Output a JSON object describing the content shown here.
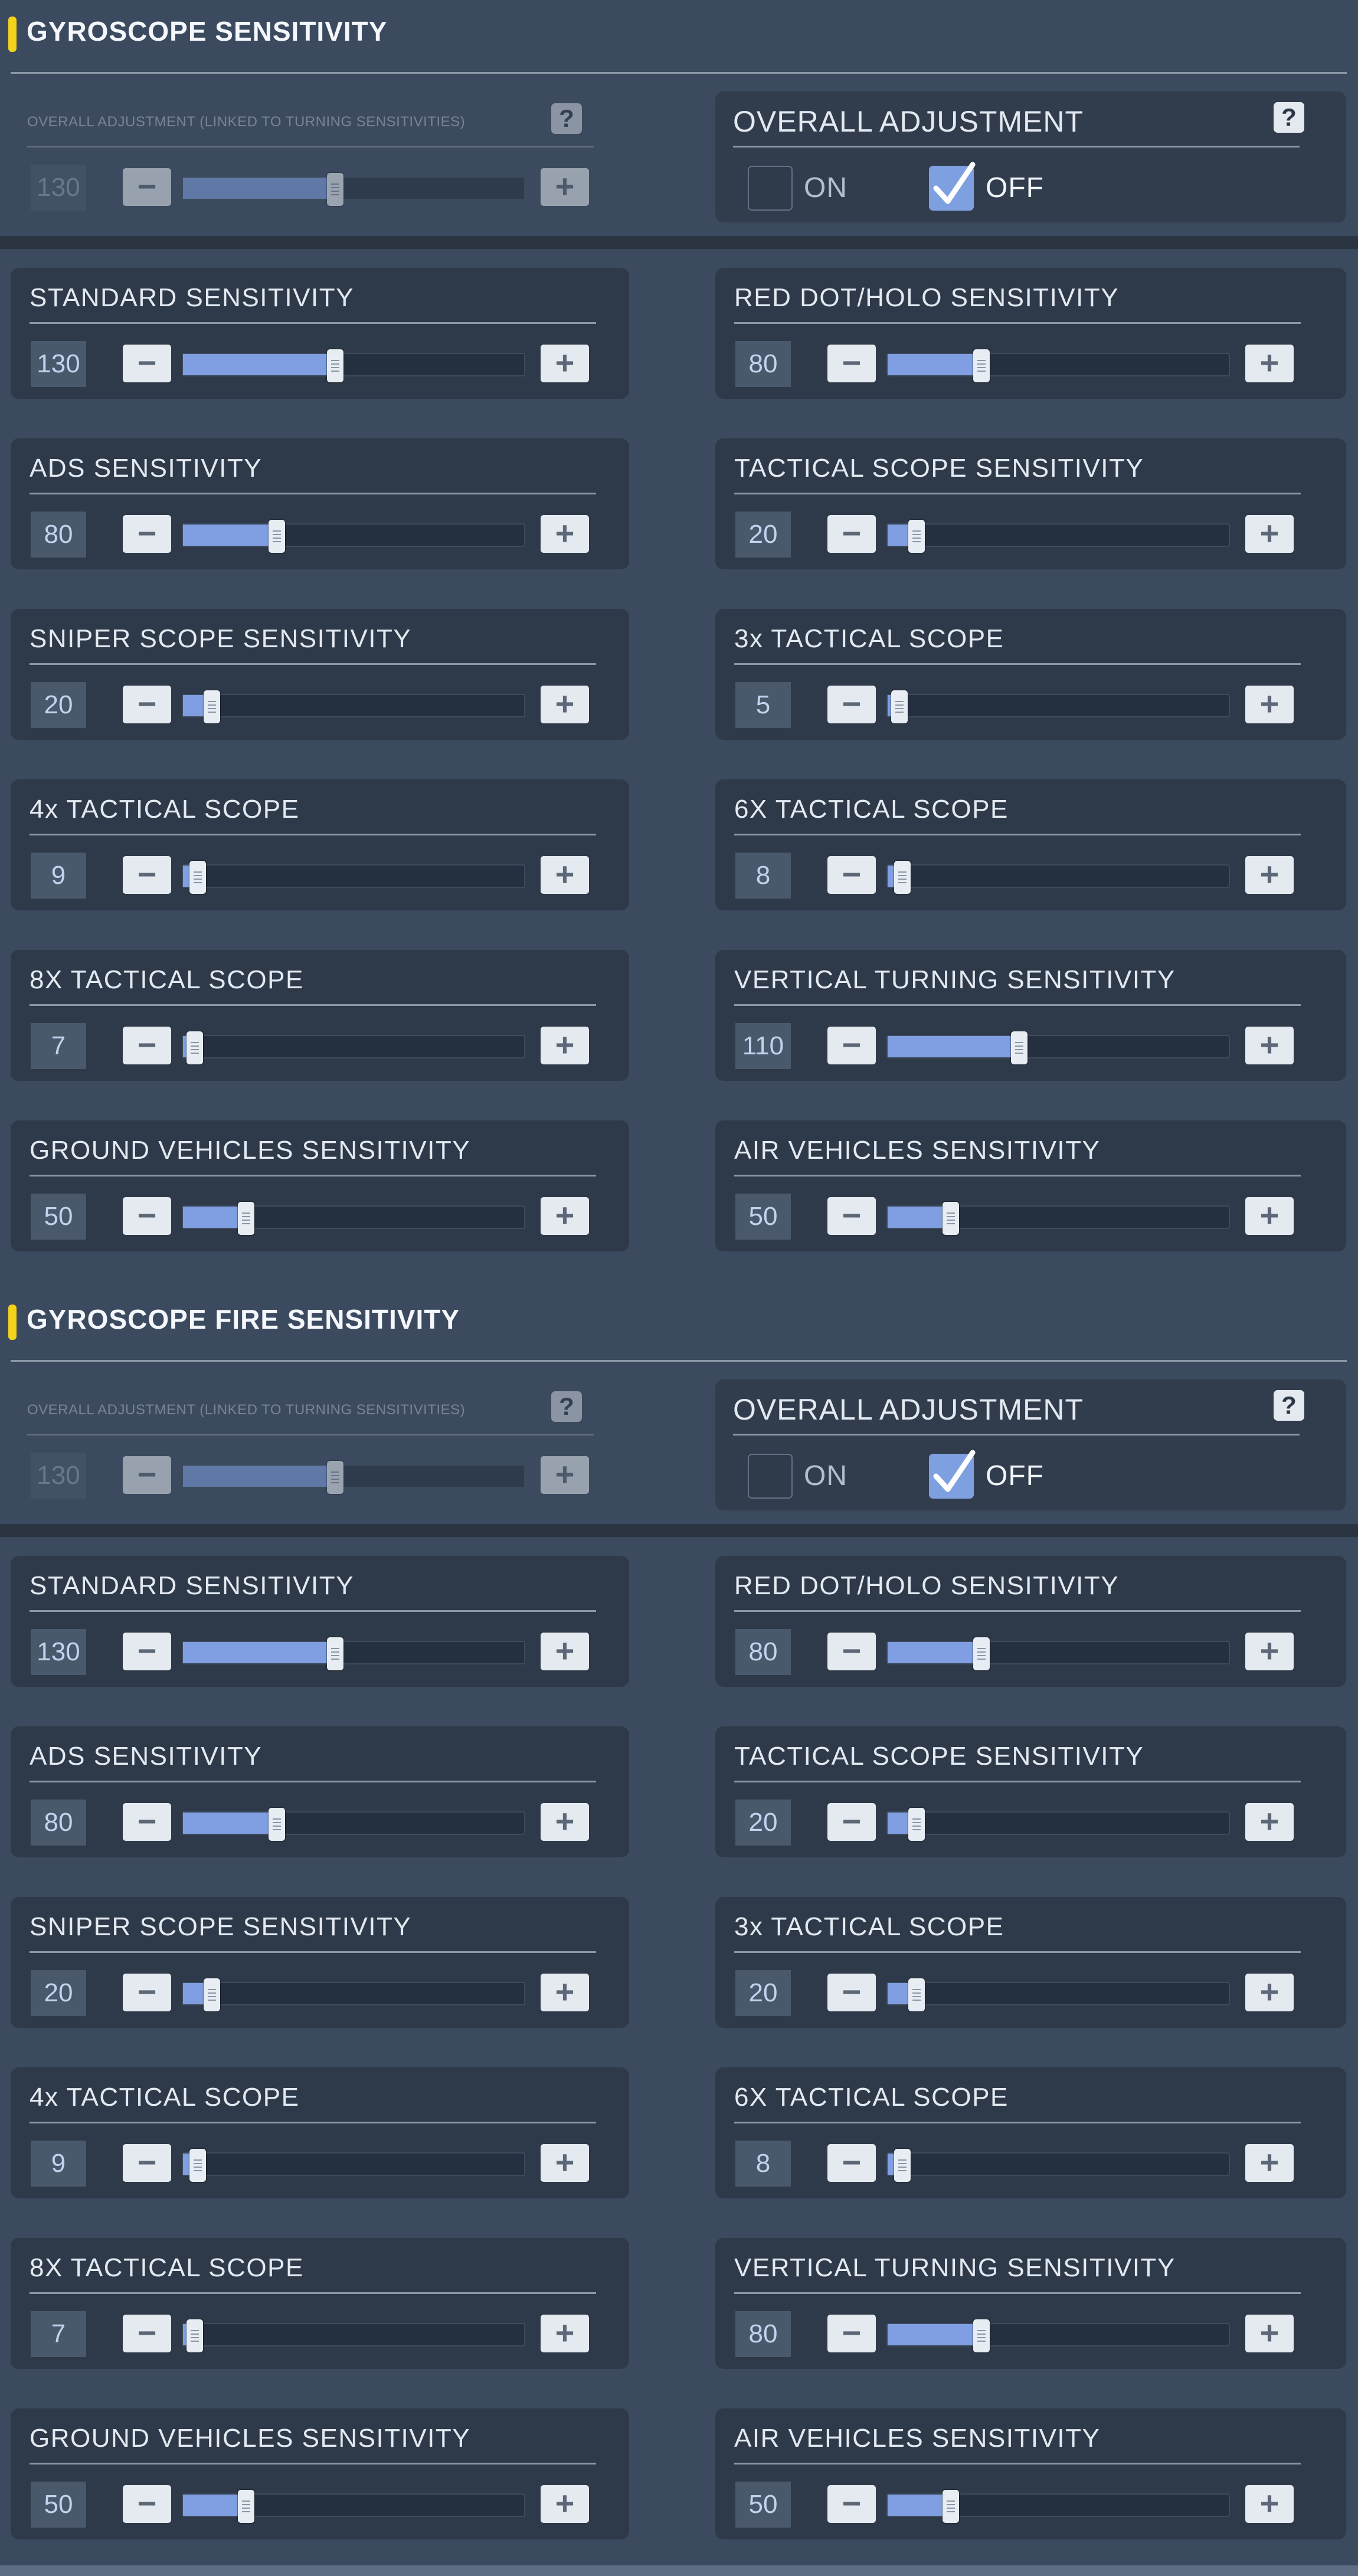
{
  "sections": [
    {
      "title": "GYROSCOPE SENSITIVITY",
      "overall_left": {
        "label": "OVERALL ADJUSTMENT (LINKED TO TURNING SENSITIVITIES)",
        "value": "130",
        "level": 0.43,
        "help_icon": "question-icon"
      },
      "overall_right": {
        "label": "OVERALL ADJUSTMENT",
        "on_label": "ON",
        "off_label": "OFF",
        "on_checked": false,
        "off_checked": true
      },
      "sliders": [
        {
          "label": "STANDARD SENSITIVITY",
          "value": "130",
          "level": 0.43
        },
        {
          "label": "RED DOT/HOLO SENSITIVITY",
          "value": "80",
          "level": 0.26
        },
        {
          "label": "ADS SENSITIVITY",
          "value": "80",
          "level": 0.26
        },
        {
          "label": "TACTICAL SCOPE SENSITIVITY",
          "value": "20",
          "level": 0.07
        },
        {
          "label": "SNIPER SCOPE SENSITIVITY",
          "value": "20",
          "level": 0.07
        },
        {
          "label": "3x TACTICAL SCOPE",
          "value": "5",
          "level": 0.02
        },
        {
          "label": "4x TACTICAL SCOPE",
          "value": "9",
          "level": 0.03
        },
        {
          "label": "6X TACTICAL SCOPE",
          "value": "8",
          "level": 0.03
        },
        {
          "label": "8X TACTICAL SCOPE",
          "value": "7",
          "level": 0.02
        },
        {
          "label": "VERTICAL TURNING SENSITIVITY",
          "value": "110",
          "level": 0.37
        },
        {
          "label": "GROUND VEHICLES SENSITIVITY",
          "value": "50",
          "level": 0.17
        },
        {
          "label": "AIR VEHICLES SENSITIVITY",
          "value": "50",
          "level": 0.17
        }
      ]
    },
    {
      "title": "GYROSCOPE FIRE SENSITIVITY",
      "overall_left": {
        "label": "OVERALL ADJUSTMENT (LINKED TO TURNING SENSITIVITIES)",
        "value": "130",
        "level": 0.43,
        "help_icon": "question-icon"
      },
      "overall_right": {
        "label": "OVERALL ADJUSTMENT",
        "on_label": "ON",
        "off_label": "OFF",
        "on_checked": false,
        "off_checked": true
      },
      "sliders": [
        {
          "label": "STANDARD SENSITIVITY",
          "value": "130",
          "level": 0.43
        },
        {
          "label": "RED DOT/HOLO SENSITIVITY",
          "value": "80",
          "level": 0.26
        },
        {
          "label": "ADS SENSITIVITY",
          "value": "80",
          "level": 0.26
        },
        {
          "label": "TACTICAL SCOPE SENSITIVITY",
          "value": "20",
          "level": 0.07
        },
        {
          "label": "SNIPER SCOPE SENSITIVITY",
          "value": "20",
          "level": 0.07
        },
        {
          "label": "3x TACTICAL SCOPE",
          "value": "20",
          "level": 0.07
        },
        {
          "label": "4x TACTICAL SCOPE",
          "value": "9",
          "level": 0.03
        },
        {
          "label": "6X TACTICAL SCOPE",
          "value": "8",
          "level": 0.03
        },
        {
          "label": "8X TACTICAL SCOPE",
          "value": "7",
          "level": 0.02
        },
        {
          "label": "VERTICAL TURNING SENSITIVITY",
          "value": "80",
          "level": 0.26
        },
        {
          "label": "GROUND VEHICLES SENSITIVITY",
          "value": "50",
          "level": 0.17
        },
        {
          "label": "AIR VEHICLES SENSITIVITY",
          "value": "50",
          "level": 0.17
        }
      ]
    }
  ],
  "buttons": {
    "minus": "−",
    "plus": "+"
  },
  "help_glyph": "?",
  "colors": {
    "accent": "#7f9fe2",
    "section_marker": "#f2d21b",
    "panel": "#2e3949",
    "background": "#3b4a5e"
  }
}
